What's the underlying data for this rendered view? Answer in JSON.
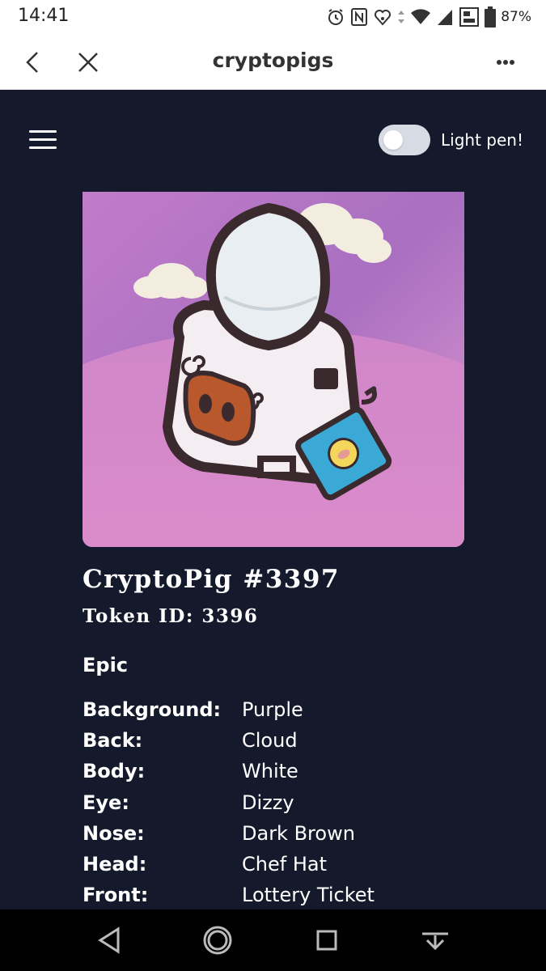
{
  "status_bar": {
    "time": "14:41",
    "battery_percent": "87%",
    "icons": [
      "alarm-icon",
      "nfc-icon",
      "signal-booster-icon",
      "wifi-icon",
      "cell-signal-icon",
      "data-icon",
      "battery-icon"
    ]
  },
  "browser": {
    "title": "cryptopigs",
    "back_icon": "chevron-left-icon",
    "close_icon": "close-icon",
    "more_icon": "more-horizontal-icon"
  },
  "app": {
    "menu_icon": "hamburger-menu-icon",
    "theme_toggle_label": "Light pen!",
    "theme_toggle_on": false
  },
  "pig": {
    "title": "CryptoPig #3397",
    "token_id": "Token ID: 3396",
    "rarity": "Epic",
    "attributes": [
      {
        "key": "Background:",
        "value": "Purple"
      },
      {
        "key": "Back:",
        "value": "Cloud"
      },
      {
        "key": "Body:",
        "value": "White"
      },
      {
        "key": "Eye:",
        "value": "Dizzy"
      },
      {
        "key": "Nose:",
        "value": "Dark Brown"
      },
      {
        "key": "Head:",
        "value": "Chef Hat"
      },
      {
        "key": "Front:",
        "value": "Lottery Ticket"
      }
    ],
    "image_background_color": "#b87cc8"
  },
  "navbar": {
    "buttons": [
      "back-triangle-icon",
      "home-circle-icon",
      "recents-square-icon",
      "hide-keyboard-icon"
    ]
  },
  "colors": {
    "page_background": "#141a2b",
    "toggle_track": "#d7dbe3",
    "text": "#ffffff"
  }
}
